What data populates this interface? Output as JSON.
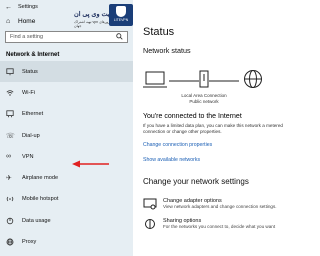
{
  "window": {
    "title": "Settings",
    "back_icon": "back-arrow-icon"
  },
  "sidebar": {
    "home_label": "Home",
    "search_placeholder": "Find a setting",
    "section_title": "Network & Internet",
    "items": [
      {
        "label": "Status",
        "icon": "status-icon",
        "active": true
      },
      {
        "label": "Wi-Fi",
        "icon": "wifi-icon",
        "active": false
      },
      {
        "label": "Ethernet",
        "icon": "ethernet-icon",
        "active": false
      },
      {
        "label": "Dial-up",
        "icon": "dialup-icon",
        "active": false
      },
      {
        "label": "VPN",
        "icon": "vpn-icon",
        "active": false
      },
      {
        "label": "Airplane mode",
        "icon": "airplane-icon",
        "active": false
      },
      {
        "label": "Mobile hotspot",
        "icon": "hotspot-icon",
        "active": false
      },
      {
        "label": "Data usage",
        "icon": "data-usage-icon",
        "active": false
      },
      {
        "label": "Proxy",
        "icon": "globe-icon",
        "active": false
      }
    ],
    "annotation_arrow_color": "#e02020"
  },
  "logo": {
    "title": "لایت وی پی ان",
    "subtitle": "تهیه اشتراک vpn با تمامی سرورهای جهان",
    "badge_text": "LITEVPN"
  },
  "main": {
    "title": "Status",
    "network_status_heading": "Network status",
    "connection_name": "Local Area Connection",
    "connection_type": "Public network",
    "connected_message": "You're connected to the Internet",
    "connected_description": "If you have a limited data plan, you can make this network a metered connection or change other properties.",
    "change_connection_link": "Change connection properties",
    "show_networks_link": "Show available networks",
    "change_settings_heading": "Change your network settings",
    "change_items": [
      {
        "title": "Change adapter options",
        "description": "View network adapters and change connection settings."
      },
      {
        "title": "Sharing options",
        "description": "For the networks you connect to, decide what you want"
      }
    ]
  },
  "colors": {
    "accent": "#1b5fb5",
    "sidebar_bg": "#e6eef3",
    "arrow": "#e02020"
  }
}
